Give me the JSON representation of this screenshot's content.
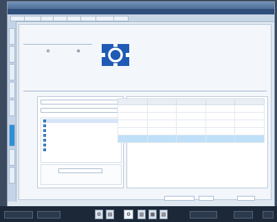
{
  "window": {
    "title": ""
  },
  "menu": {
    "items": [
      "",
      "",
      "",
      "",
      "",
      "",
      ""
    ]
  },
  "tabs": [
    "",
    "",
    "",
    "",
    "",
    "",
    "",
    "",
    ""
  ],
  "mode_section": {
    "title": "",
    "option_a": "",
    "option_b": "",
    "notice_primary": "",
    "notice_warning": ""
  },
  "details_section": {
    "title": ""
  },
  "left_panel": {
    "combo1": "",
    "combo2": "",
    "rows": [
      {
        "key": "",
        "value": ""
      },
      {
        "key": "",
        "value": ""
      },
      {
        "key": "",
        "value": ""
      },
      {
        "key": "",
        "value": ""
      },
      {
        "key": "",
        "value": ""
      },
      {
        "key": "",
        "value": ""
      },
      {
        "key": "",
        "value": ""
      }
    ],
    "bottom_button": ""
  },
  "table": {
    "headers": [
      "",
      "",
      "",
      "",
      ""
    ],
    "rows": [
      [
        "",
        "",
        "",
        "",
        ""
      ],
      [
        "",
        "",
        "",
        "",
        ""
      ],
      [
        "",
        "",
        "",
        "",
        ""
      ],
      [
        "",
        "",
        "",
        "",
        ""
      ],
      [
        "",
        "",
        "",
        "",
        ""
      ]
    ],
    "selected_row": 4
  },
  "pager": {
    "label": "",
    "page": "",
    "next": "",
    "last": ""
  },
  "taskbar": {
    "start": "",
    "item1": "",
    "item2": "",
    "item3": ""
  },
  "colors": {
    "accent": "#1f5bb5",
    "notice": "#1d3f8a",
    "warning": "#c03a2b",
    "selection": "#bfe0f8"
  },
  "icons": [
    "app-logo-icon",
    "chevron-down-icon",
    "settings-icon",
    "save-icon",
    "print-icon",
    "export-icon"
  ]
}
